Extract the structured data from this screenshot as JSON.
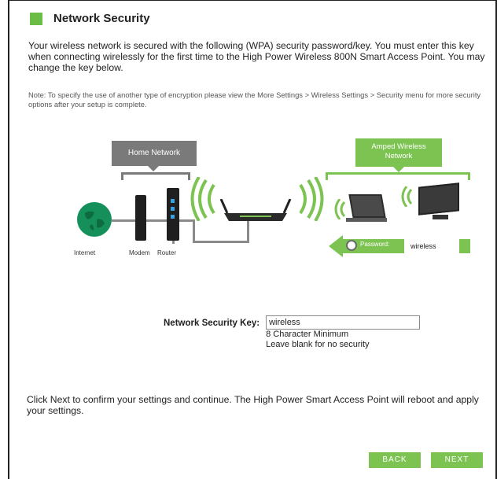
{
  "page": {
    "heading": "Network Security",
    "intro": "Your wireless network is secured with the following (WPA) security password/key. You must enter this key when connecting wirelessly for the first time to the High Power Wireless 800N Smart Access Point. You may change the key below.",
    "note": "Note: To specify the use of another type of encryption please view the More Settings > Wireless Settings > Security menu for more security options after your setup is complete.",
    "confirm_text": "Click Next to confirm your settings and continue. The High Power Smart Access Point will reboot and apply your settings."
  },
  "diagram": {
    "home_network_label": "Home Network",
    "amped_network_label_1": "Amped Wireless",
    "amped_network_label_2": "Network",
    "internet_label": "Internet",
    "modem_label": "Modem",
    "router_label": "Router",
    "password_label": "Password:",
    "password_value": "wireless"
  },
  "form": {
    "key_label": "Network Security Key:",
    "key_value": "wireless",
    "hint_min": "8 Character Minimum",
    "hint_blank": "Leave blank for no security"
  },
  "buttons": {
    "back": "BACK",
    "next": "NEXT"
  },
  "colors": {
    "accent_green": "#7dc352",
    "heading_square": "#6cbd45",
    "home_gray": "#7a7a7a",
    "globe_green": "#16905a"
  }
}
